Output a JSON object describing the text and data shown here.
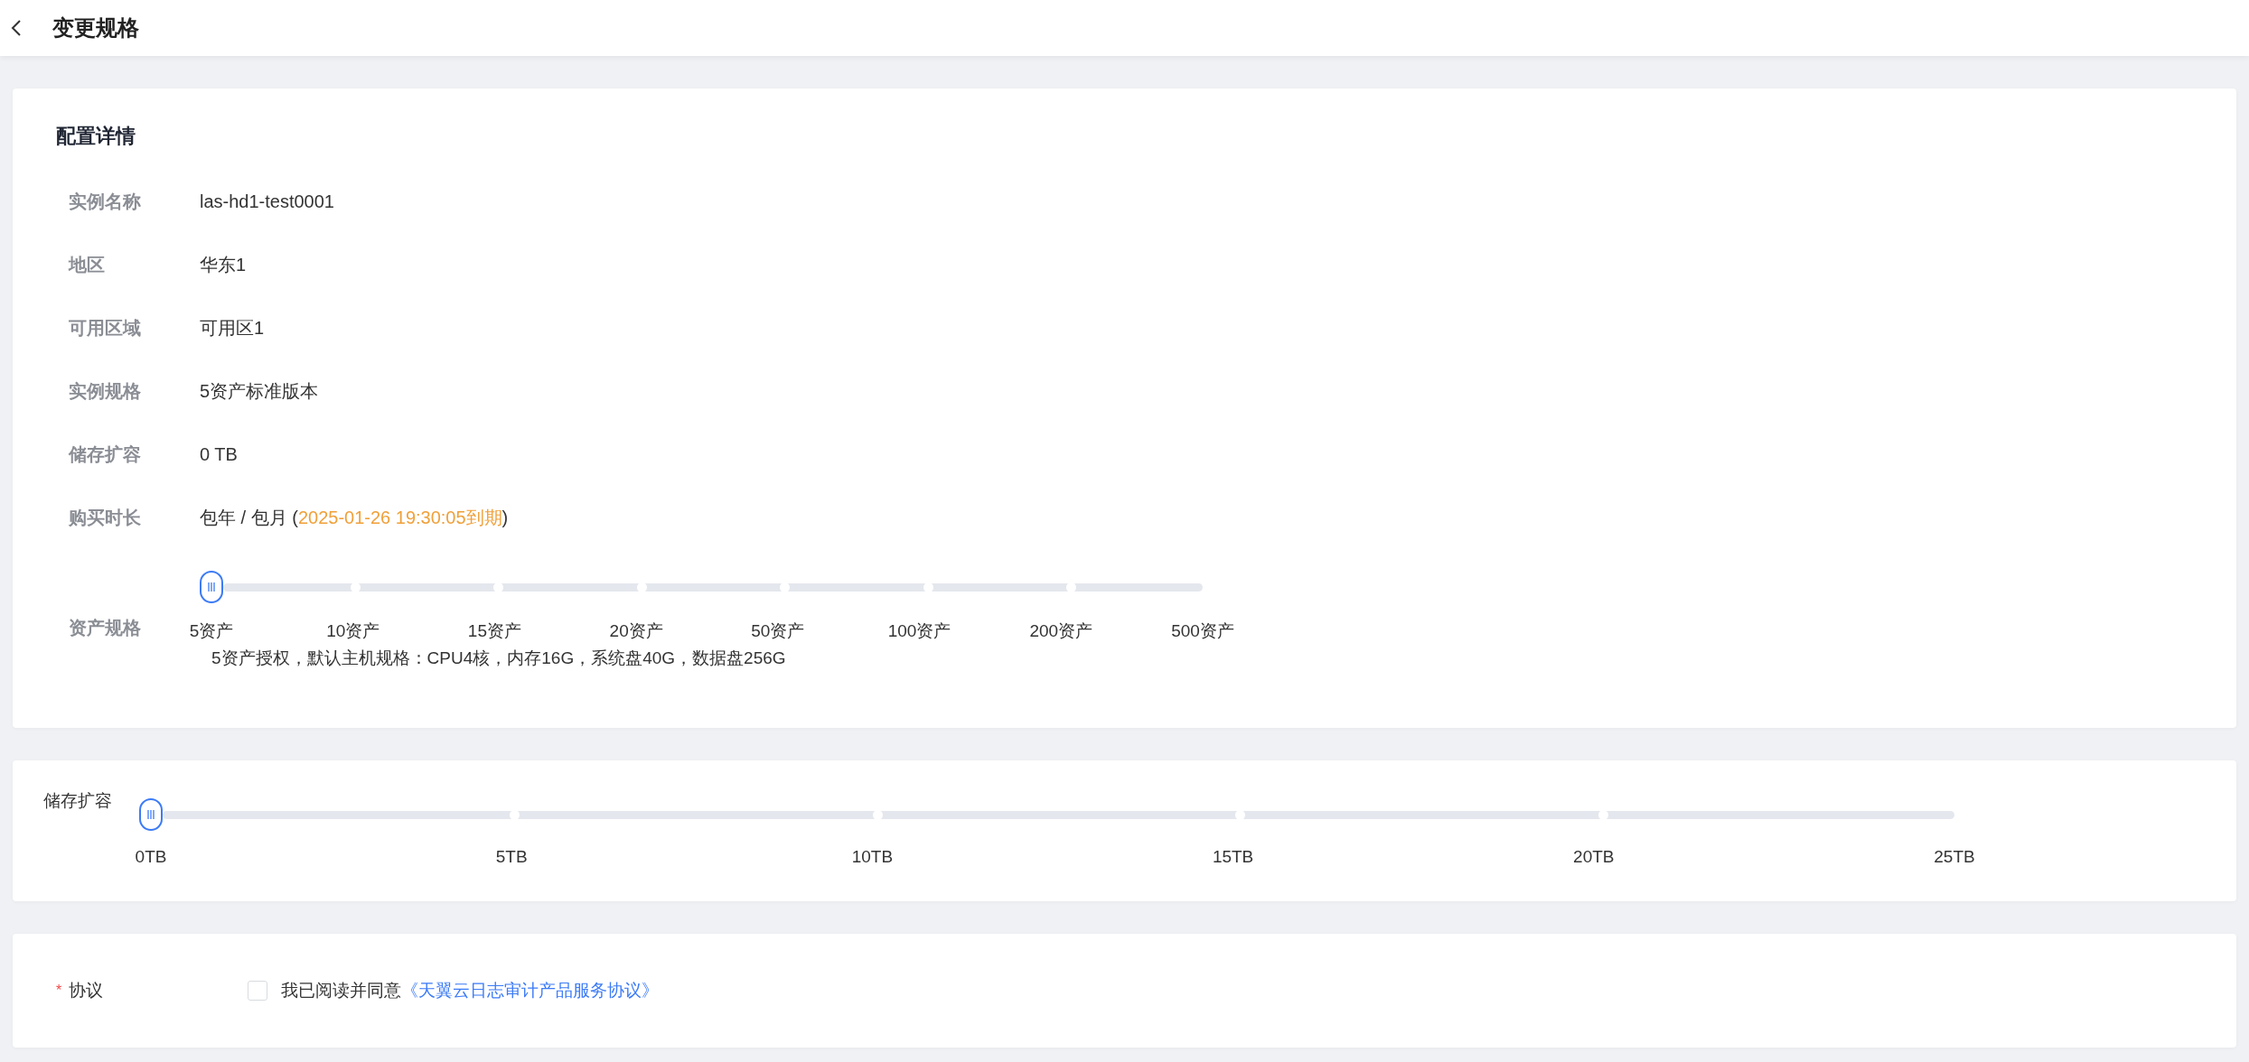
{
  "header": {
    "title": "变更规格"
  },
  "config": {
    "title": "配置详情",
    "rows": [
      {
        "label": "实例名称",
        "value": "las-hd1-test0001"
      },
      {
        "label": "地区",
        "value": "华东1"
      },
      {
        "label": "可用区域",
        "value": "可用区1"
      },
      {
        "label": "实例规格",
        "value": "5资产标准版本"
      },
      {
        "label": "储存扩容",
        "value": "0 TB"
      },
      {
        "label": "购买时长",
        "value": "包年 / 包月 (",
        "highlight": "2025-01-26 19:30:05到期",
        "suffix": ")"
      }
    ],
    "asset_spec": {
      "label": "资产规格",
      "slider": {
        "level": 0,
        "stops": [
          "5资产",
          "10资产",
          "15资产",
          "20资产",
          "50资产",
          "100资产",
          "200资产",
          "500资产"
        ]
      },
      "note": "5资产授权，默认主机规格：CPU4核，内存16G，系统盘40G，数据盘256G"
    }
  },
  "storage": {
    "label": "储存扩容",
    "slider": {
      "level": 0,
      "stops": [
        "0TB",
        "5TB",
        "10TB",
        "15TB",
        "20TB",
        "25TB"
      ]
    }
  },
  "agreement": {
    "required_mark": "*",
    "label": "协议",
    "checked": false,
    "text": "我已阅读并同意",
    "link": "《天翼云日志审计产品服务协议》"
  }
}
